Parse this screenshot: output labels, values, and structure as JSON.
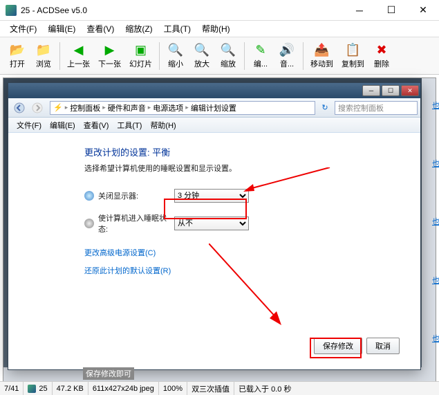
{
  "window": {
    "title": "25 - ACDSee v5.0"
  },
  "menubar": {
    "file": "文件(F)",
    "edit": "编辑(E)",
    "view": "查看(V)",
    "zoom": "缩放(Z)",
    "tools": "工具(T)",
    "help": "帮助(H)"
  },
  "toolbar": {
    "open": "打开",
    "browse": "浏览",
    "prev": "上一张",
    "next": "下一张",
    "slide": "幻灯片",
    "zoomout": "缩小",
    "zoomin": "放大",
    "zoom": "缩放",
    "editm": "编...",
    "audio": "音...",
    "moveto": "移动到",
    "copyto": "复制到",
    "delete": "删除"
  },
  "inner": {
    "breadcrumb": {
      "cp": "控制面板",
      "hw": "硬件和声音",
      "power": "电源选项",
      "edit": "编辑计划设置"
    },
    "search_placeholder": "搜索控制面板",
    "menu": {
      "file": "文件(F)",
      "edit": "编辑(E)",
      "view": "查看(V)",
      "tools": "工具(T)",
      "help": "帮助(H)"
    },
    "heading": "更改计划的设置: 平衡",
    "subtitle": "选择希望计算机使用的睡眠设置和显示设置。",
    "row1_label": "关闭显示器:",
    "row1_value": "3 分钟",
    "row2_label": "使计算机进入睡眠状态:",
    "row2_value": "从不",
    "link1": "更改高级电源设置(C)",
    "link2": "还原此计划的默认设置(R)",
    "save": "保存修改",
    "cancel": "取消"
  },
  "status": {
    "pos": "7/41",
    "num": "25",
    "size": "47.2 KB",
    "dim": "611x427x24b jpeg",
    "zoom": "100%",
    "interp": "双三次插值",
    "loaded": "已载入于 0.0 秒",
    "extra": "保存修改即可"
  }
}
